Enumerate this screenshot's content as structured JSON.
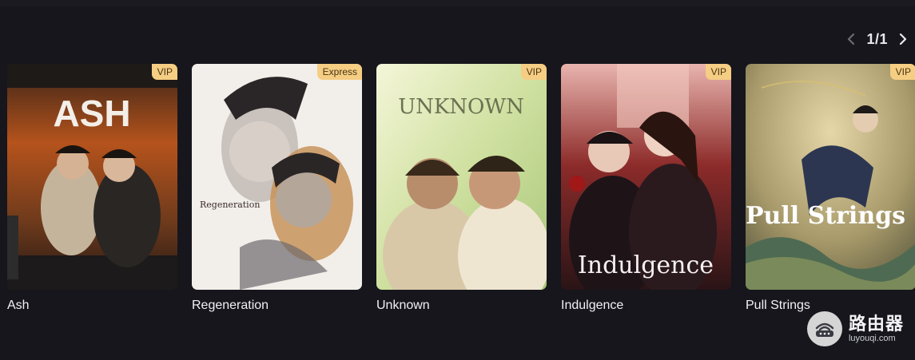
{
  "pager": {
    "prev_icon": "chevron-left-icon",
    "next_icon": "chevron-right-icon",
    "page_text": "1/1"
  },
  "cards": [
    {
      "title": "Ash",
      "badge": "VIP",
      "poster_text": "ASH"
    },
    {
      "title": "Regeneration",
      "badge": "Express",
      "poster_text": "Regeneration"
    },
    {
      "title": "Unknown",
      "badge": "VIP",
      "poster_text": "UNKNOWN"
    },
    {
      "title": "Indulgence",
      "badge": "VIP",
      "poster_text": "Indulgence"
    },
    {
      "title": "Pull Strings",
      "badge": "VIP",
      "poster_text": "Pull Strings"
    }
  ],
  "watermark": {
    "icon": "router-icon",
    "cn_text": "路由器",
    "en_text": "luyouqi.com"
  },
  "colors": {
    "background": "#16161c",
    "badge_bg": "#f5cd83",
    "badge_text": "#4a3512"
  }
}
